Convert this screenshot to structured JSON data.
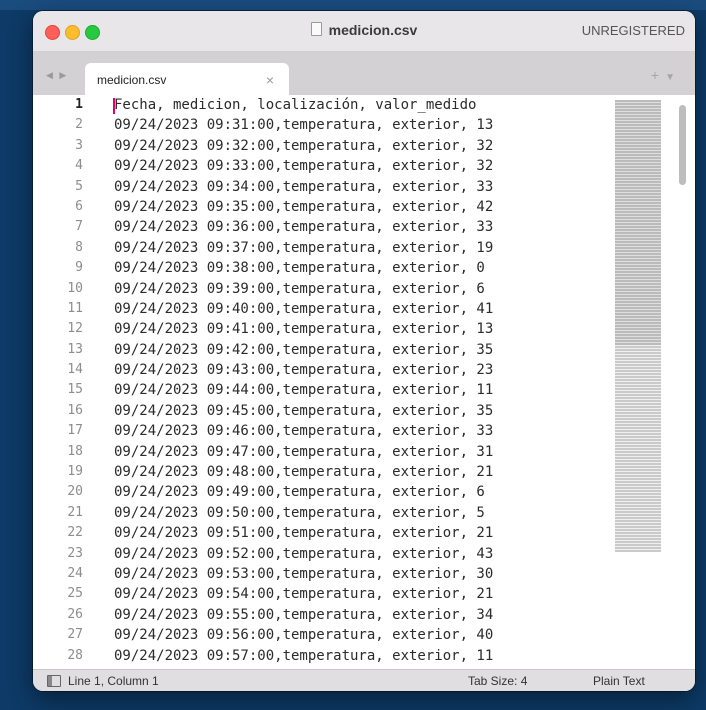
{
  "window": {
    "title": "medicion.csv",
    "license_status": "UNREGISTERED"
  },
  "tabs": [
    {
      "label": "medicion.csv",
      "close": "×",
      "active": true
    }
  ],
  "tab_actions": {
    "new_tab": "+",
    "tab_menu": "▼"
  },
  "nav_arrows": "◀ ▶",
  "editor": {
    "active_line": 1,
    "lines": [
      {
        "n": "1",
        "text": "Fecha, medicion, localización, valor_medido"
      },
      {
        "n": "2",
        "text": "09/24/2023 09:31:00,temperatura, exterior, 13"
      },
      {
        "n": "3",
        "text": "09/24/2023 09:32:00,temperatura, exterior, 32"
      },
      {
        "n": "4",
        "text": "09/24/2023 09:33:00,temperatura, exterior, 32"
      },
      {
        "n": "5",
        "text": "09/24/2023 09:34:00,temperatura, exterior, 33"
      },
      {
        "n": "6",
        "text": "09/24/2023 09:35:00,temperatura, exterior, 42"
      },
      {
        "n": "7",
        "text": "09/24/2023 09:36:00,temperatura, exterior, 33"
      },
      {
        "n": "8",
        "text": "09/24/2023 09:37:00,temperatura, exterior, 19"
      },
      {
        "n": "9",
        "text": "09/24/2023 09:38:00,temperatura, exterior, 0"
      },
      {
        "n": "10",
        "text": "09/24/2023 09:39:00,temperatura, exterior, 6"
      },
      {
        "n": "11",
        "text": "09/24/2023 09:40:00,temperatura, exterior, 41"
      },
      {
        "n": "12",
        "text": "09/24/2023 09:41:00,temperatura, exterior, 13"
      },
      {
        "n": "13",
        "text": "09/24/2023 09:42:00,temperatura, exterior, 35"
      },
      {
        "n": "14",
        "text": "09/24/2023 09:43:00,temperatura, exterior, 23"
      },
      {
        "n": "15",
        "text": "09/24/2023 09:44:00,temperatura, exterior, 11"
      },
      {
        "n": "16",
        "text": "09/24/2023 09:45:00,temperatura, exterior, 35"
      },
      {
        "n": "17",
        "text": "09/24/2023 09:46:00,temperatura, exterior, 33"
      },
      {
        "n": "18",
        "text": "09/24/2023 09:47:00,temperatura, exterior, 31"
      },
      {
        "n": "19",
        "text": "09/24/2023 09:48:00,temperatura, exterior, 21"
      },
      {
        "n": "20",
        "text": "09/24/2023 09:49:00,temperatura, exterior, 6"
      },
      {
        "n": "21",
        "text": "09/24/2023 09:50:00,temperatura, exterior, 5"
      },
      {
        "n": "22",
        "text": "09/24/2023 09:51:00,temperatura, exterior, 21"
      },
      {
        "n": "23",
        "text": "09/24/2023 09:52:00,temperatura, exterior, 43"
      },
      {
        "n": "24",
        "text": "09/24/2023 09:53:00,temperatura, exterior, 30"
      },
      {
        "n": "25",
        "text": "09/24/2023 09:54:00,temperatura, exterior, 21"
      },
      {
        "n": "26",
        "text": "09/24/2023 09:55:00,temperatura, exterior, 34"
      },
      {
        "n": "27",
        "text": "09/24/2023 09:56:00,temperatura, exterior, 40"
      },
      {
        "n": "28",
        "text": "09/24/2023 09:57:00,temperatura, exterior, 11"
      }
    ]
  },
  "status_bar": {
    "cursor_position": "Line 1, Column 1",
    "tab_size": "Tab Size: 4",
    "syntax": "Plain Text"
  },
  "colors": {
    "desktop": "#0d3a66",
    "caret": "#e0006e",
    "close_button": "#ff5f57",
    "minimize_button": "#febc2e",
    "zoom_button": "#28c840"
  },
  "icons": {
    "file": "file-icon",
    "sidebar_toggle": "panel-toggle-icon"
  }
}
